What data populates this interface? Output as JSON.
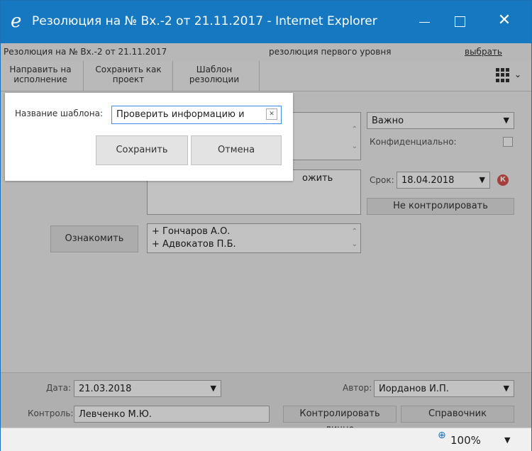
{
  "window": {
    "title": "Резолюция на № Вх.-2 от 21.11.2017 - Internet Explorer",
    "ie_glyph": "e",
    "close_glyph": "✕"
  },
  "infobar": {
    "doc_title": "Резолюция на № Вх.-2 от 21.11.2017",
    "level": "резолюция первого уровня",
    "choose_link": "выбрать"
  },
  "toolbar": {
    "send_line1": "Направить на",
    "send_line2": "исполнение",
    "save_line1": "Сохранить как",
    "save_line2": "проект",
    "template_line1": "Шаблон",
    "template_line2": "резолюции",
    "menu_icon": "grid-menu-icon",
    "chevron": "⌄"
  },
  "resolution": {
    "priority_value": "Важно",
    "confidential_label": "Конфиденциально:",
    "text_visible": "ожить",
    "deadline_label": "Срок:",
    "deadline_value": "18.04.2018",
    "control_badge": "К",
    "no_control_button": "Не контролировать",
    "familiarize_button": "Ознакомить",
    "recipients": [
      "+ Гончаров А.О.",
      "+ Адвокатов П.Б."
    ]
  },
  "bottom": {
    "date_label": "Дата:",
    "date_value": "21.03.2018",
    "author_label": "Автор:",
    "author_value": "Иорданов И.П.",
    "control_label": "Контроль:",
    "control_value": "Левченко М.Ю.",
    "control_personally_button": "Контролировать лично",
    "reference_button": "Справочник"
  },
  "dialog": {
    "name_label": "Название шаблона:",
    "name_value": "Проверить информацию и",
    "clear_glyph": "✕",
    "save_button": "Сохранить",
    "cancel_button": "Отмена"
  },
  "statusbar": {
    "zoom_value": "100%",
    "zoom_glyph": "⊕",
    "dropdown_glyph": "▼"
  },
  "colors": {
    "titlebar": "#1778c2",
    "badge": "#d9534f"
  }
}
